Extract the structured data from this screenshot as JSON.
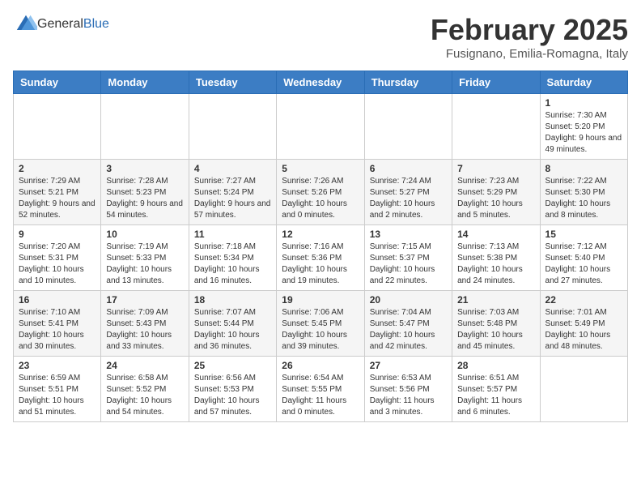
{
  "header": {
    "logo_general": "General",
    "logo_blue": "Blue",
    "title": "February 2025",
    "subtitle": "Fusignano, Emilia-Romagna, Italy"
  },
  "calendar": {
    "headers": [
      "Sunday",
      "Monday",
      "Tuesday",
      "Wednesday",
      "Thursday",
      "Friday",
      "Saturday"
    ],
    "weeks": [
      [
        {
          "day": "",
          "info": ""
        },
        {
          "day": "",
          "info": ""
        },
        {
          "day": "",
          "info": ""
        },
        {
          "day": "",
          "info": ""
        },
        {
          "day": "",
          "info": ""
        },
        {
          "day": "",
          "info": ""
        },
        {
          "day": "1",
          "info": "Sunrise: 7:30 AM\nSunset: 5:20 PM\nDaylight: 9 hours and 49 minutes."
        }
      ],
      [
        {
          "day": "2",
          "info": "Sunrise: 7:29 AM\nSunset: 5:21 PM\nDaylight: 9 hours and 52 minutes."
        },
        {
          "day": "3",
          "info": "Sunrise: 7:28 AM\nSunset: 5:23 PM\nDaylight: 9 hours and 54 minutes."
        },
        {
          "day": "4",
          "info": "Sunrise: 7:27 AM\nSunset: 5:24 PM\nDaylight: 9 hours and 57 minutes."
        },
        {
          "day": "5",
          "info": "Sunrise: 7:26 AM\nSunset: 5:26 PM\nDaylight: 10 hours and 0 minutes."
        },
        {
          "day": "6",
          "info": "Sunrise: 7:24 AM\nSunset: 5:27 PM\nDaylight: 10 hours and 2 minutes."
        },
        {
          "day": "7",
          "info": "Sunrise: 7:23 AM\nSunset: 5:29 PM\nDaylight: 10 hours and 5 minutes."
        },
        {
          "day": "8",
          "info": "Sunrise: 7:22 AM\nSunset: 5:30 PM\nDaylight: 10 hours and 8 minutes."
        }
      ],
      [
        {
          "day": "9",
          "info": "Sunrise: 7:20 AM\nSunset: 5:31 PM\nDaylight: 10 hours and 10 minutes."
        },
        {
          "day": "10",
          "info": "Sunrise: 7:19 AM\nSunset: 5:33 PM\nDaylight: 10 hours and 13 minutes."
        },
        {
          "day": "11",
          "info": "Sunrise: 7:18 AM\nSunset: 5:34 PM\nDaylight: 10 hours and 16 minutes."
        },
        {
          "day": "12",
          "info": "Sunrise: 7:16 AM\nSunset: 5:36 PM\nDaylight: 10 hours and 19 minutes."
        },
        {
          "day": "13",
          "info": "Sunrise: 7:15 AM\nSunset: 5:37 PM\nDaylight: 10 hours and 22 minutes."
        },
        {
          "day": "14",
          "info": "Sunrise: 7:13 AM\nSunset: 5:38 PM\nDaylight: 10 hours and 24 minutes."
        },
        {
          "day": "15",
          "info": "Sunrise: 7:12 AM\nSunset: 5:40 PM\nDaylight: 10 hours and 27 minutes."
        }
      ],
      [
        {
          "day": "16",
          "info": "Sunrise: 7:10 AM\nSunset: 5:41 PM\nDaylight: 10 hours and 30 minutes."
        },
        {
          "day": "17",
          "info": "Sunrise: 7:09 AM\nSunset: 5:43 PM\nDaylight: 10 hours and 33 minutes."
        },
        {
          "day": "18",
          "info": "Sunrise: 7:07 AM\nSunset: 5:44 PM\nDaylight: 10 hours and 36 minutes."
        },
        {
          "day": "19",
          "info": "Sunrise: 7:06 AM\nSunset: 5:45 PM\nDaylight: 10 hours and 39 minutes."
        },
        {
          "day": "20",
          "info": "Sunrise: 7:04 AM\nSunset: 5:47 PM\nDaylight: 10 hours and 42 minutes."
        },
        {
          "day": "21",
          "info": "Sunrise: 7:03 AM\nSunset: 5:48 PM\nDaylight: 10 hours and 45 minutes."
        },
        {
          "day": "22",
          "info": "Sunrise: 7:01 AM\nSunset: 5:49 PM\nDaylight: 10 hours and 48 minutes."
        }
      ],
      [
        {
          "day": "23",
          "info": "Sunrise: 6:59 AM\nSunset: 5:51 PM\nDaylight: 10 hours and 51 minutes."
        },
        {
          "day": "24",
          "info": "Sunrise: 6:58 AM\nSunset: 5:52 PM\nDaylight: 10 hours and 54 minutes."
        },
        {
          "day": "25",
          "info": "Sunrise: 6:56 AM\nSunset: 5:53 PM\nDaylight: 10 hours and 57 minutes."
        },
        {
          "day": "26",
          "info": "Sunrise: 6:54 AM\nSunset: 5:55 PM\nDaylight: 11 hours and 0 minutes."
        },
        {
          "day": "27",
          "info": "Sunrise: 6:53 AM\nSunset: 5:56 PM\nDaylight: 11 hours and 3 minutes."
        },
        {
          "day": "28",
          "info": "Sunrise: 6:51 AM\nSunset: 5:57 PM\nDaylight: 11 hours and 6 minutes."
        },
        {
          "day": "",
          "info": ""
        }
      ]
    ]
  }
}
